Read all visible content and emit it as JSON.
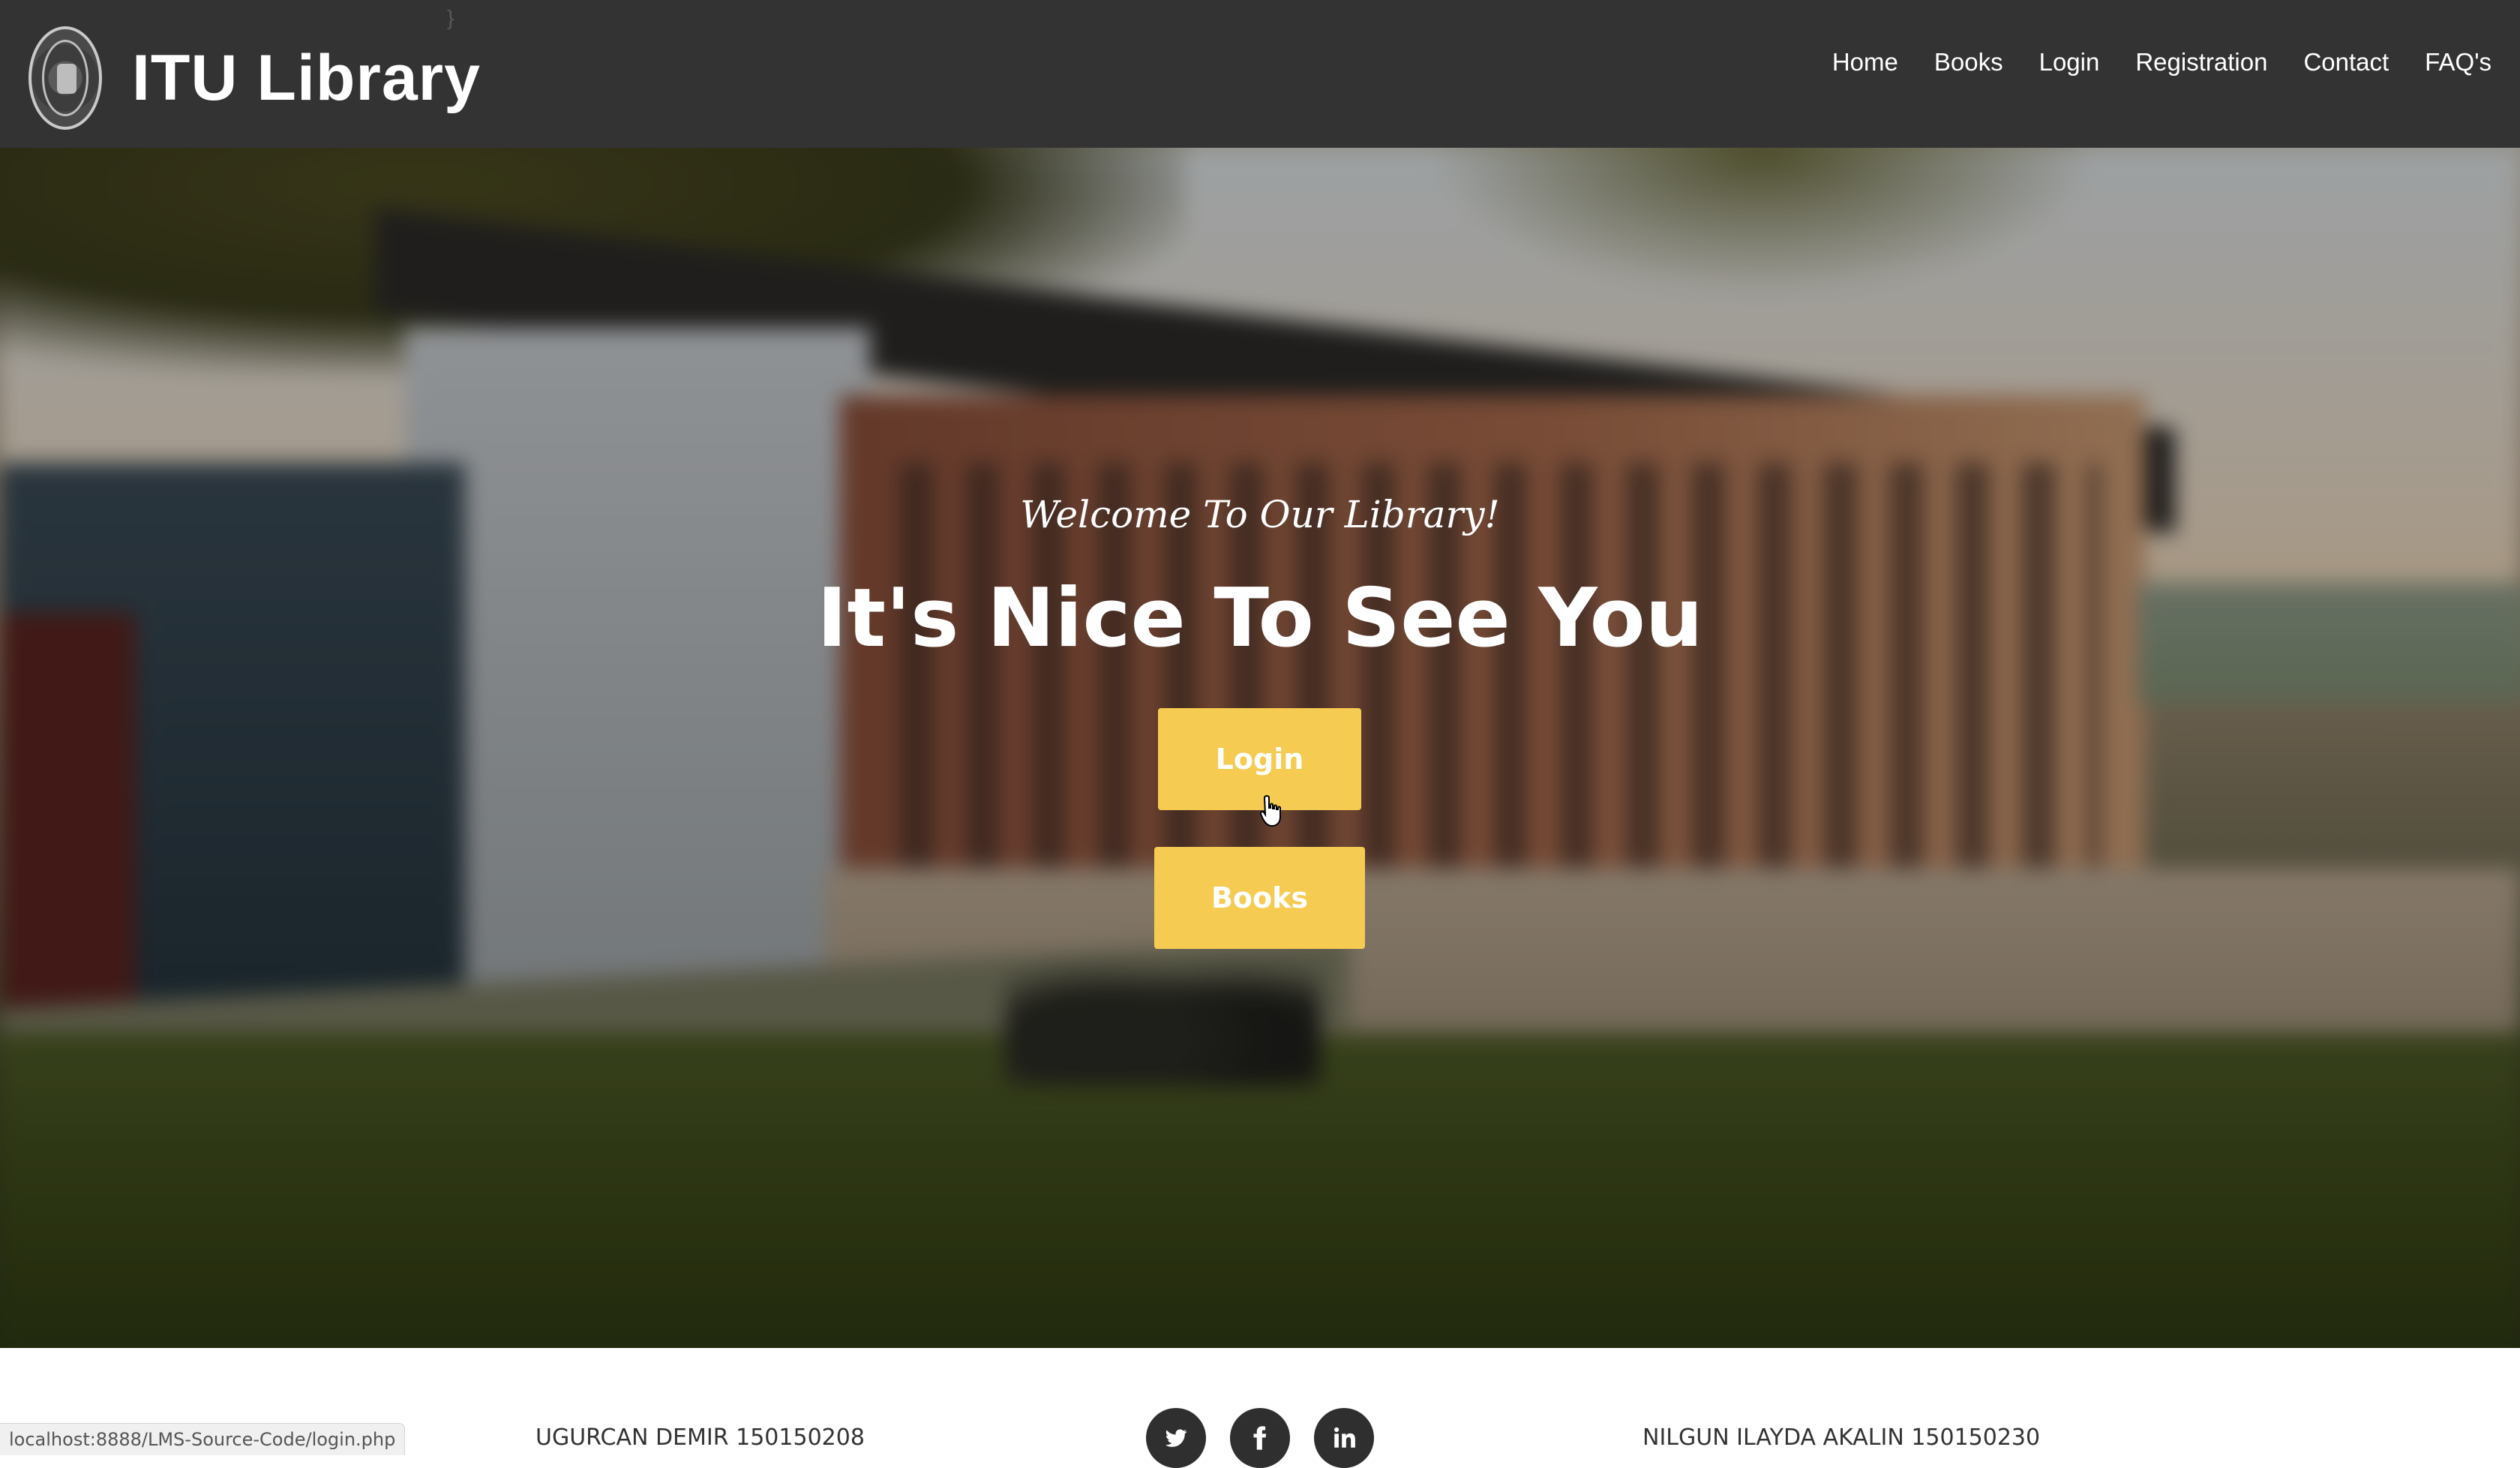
{
  "header": {
    "brand_name": "ITU Library",
    "nav": [
      "Home",
      "Books",
      "Login",
      "Registration",
      "Contact",
      "FAQ's"
    ]
  },
  "hero": {
    "welcome": "Welcome To Our Library!",
    "headline": "It's Nice To See You",
    "login_label": "Login",
    "books_label": "Books",
    "accent_color": "#f6cb52"
  },
  "footer": {
    "left_author": "UGURCAN DEMIR 150150208",
    "right_author": "NILGUN ILAYDA AKALIN 150150230",
    "social": [
      "twitter-icon",
      "facebook-icon",
      "linkedin-icon"
    ]
  },
  "status_bar": {
    "url": "localhost:8888/LMS-Source-Code/login.php"
  }
}
